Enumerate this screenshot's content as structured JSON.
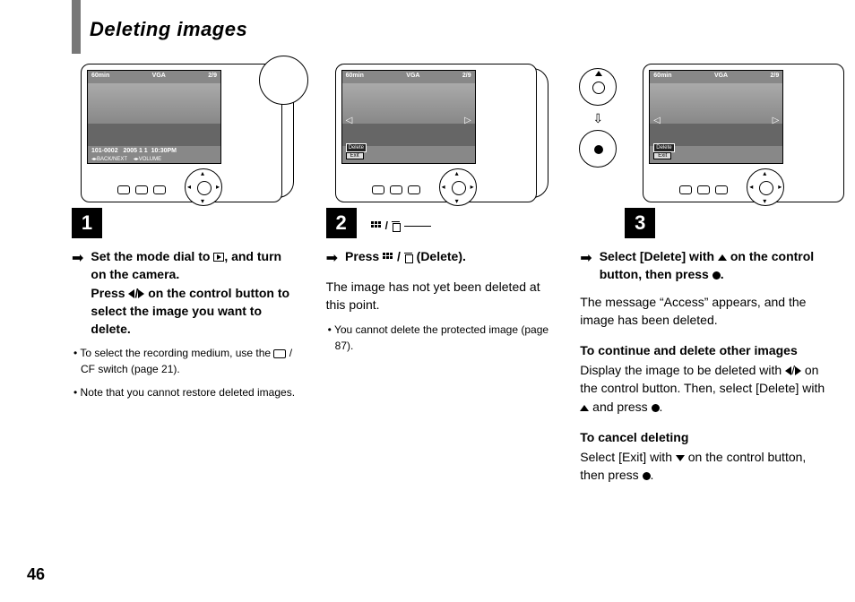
{
  "title": "Deleting images",
  "page_number": "46",
  "lcd": {
    "battery": "60min",
    "resolution": "VGA",
    "counter": "2/9",
    "folder_file": "101-0002",
    "date": "2005  1  1",
    "time": "10:30PM",
    "back_next": "BACK/NEXT",
    "volume": "VOLUME",
    "delete_label": "Delete",
    "exit_label": "Exit"
  },
  "steps": {
    "s1": {
      "num": "1",
      "instruction_a": "Set the mode dial to ",
      "instruction_b": ", and turn on the camera.",
      "instruction_c": "Press ",
      "instruction_d": " on the control button to select the image you want to delete.",
      "bullet1_a": "To select the recording medium, use the ",
      "bullet1_b": " / CF switch (page 21).",
      "bullet2": "Note that you cannot restore deleted images."
    },
    "s2": {
      "num": "2",
      "instruction_a": "Press ",
      "instruction_b": " (Delete).",
      "body": "The image has not yet been deleted at this point.",
      "bullet1": "You cannot delete the protected image (page 87)."
    },
    "s3": {
      "num": "3",
      "instruction_a": "Select [Delete] with ",
      "instruction_b": " on the control button, then press ",
      "instruction_c": ".",
      "body": "The message “Access” appears, and the image has been deleted.",
      "subhead1": "To continue and delete other images",
      "para1_a": "Display the image to be deleted with ",
      "para1_b": " on the control button. Then, select [Delete] with ",
      "para1_c": " and press ",
      "para1_d": ".",
      "subhead2": "To cancel deleting",
      "para2_a": "Select [Exit] with ",
      "para2_b": " on the control button, then press ",
      "para2_c": "."
    }
  }
}
